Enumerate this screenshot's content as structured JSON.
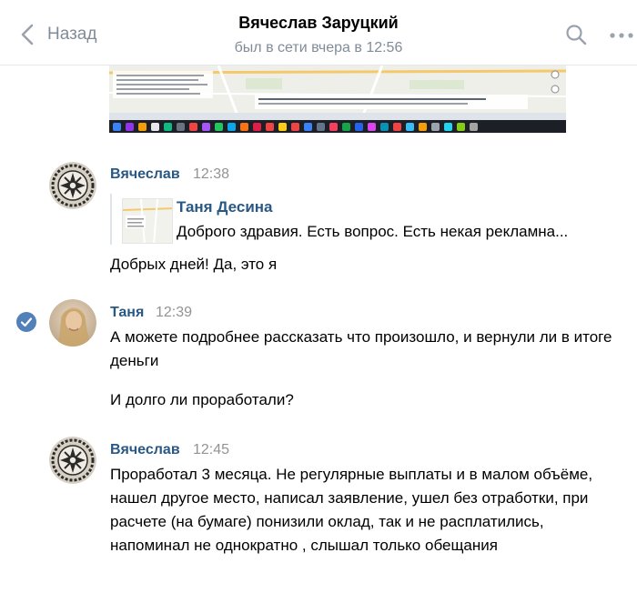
{
  "header": {
    "back_label": "Назад",
    "title": "Вячеслав Заруцкий",
    "status": "был в сети вчера в 12:56"
  },
  "colors": {
    "link": "#2a5885",
    "secondary": "#818c99",
    "accent": "#5181b8"
  },
  "messages": [
    {
      "author": "Вячеслав",
      "time": "12:38",
      "forwarded": {
        "author": "Таня Десина",
        "text": "Доброго здравия. Есть вопрос. Есть некая рекламна..."
      },
      "text": "Добрых дней! Да, это я"
    },
    {
      "author": "Таня",
      "time": "12:39",
      "text_1": "А можете подробнее рассказать что произошло, и вернули ли в итоге деньги",
      "text_2": "И долго ли проработали?"
    },
    {
      "author": "Вячеслав",
      "time": "12:45",
      "text": "Проработал 3 месяца. Не регулярные выплаты и в малом объёме, нашел другое место, написал заявление, ушел без отработки, при расчете (на бумаге) понизили оклад, так и не расплатились, напоминал не однократно , слышал только обещания"
    }
  ]
}
